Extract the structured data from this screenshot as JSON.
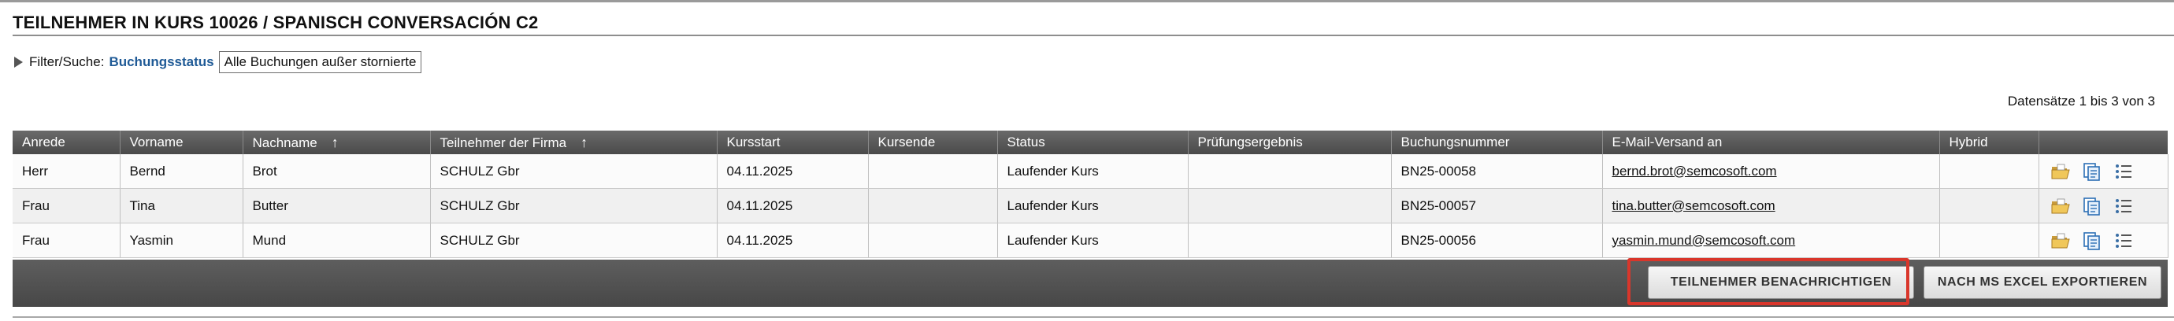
{
  "page": {
    "title": "TEILNEHMER IN KURS 10026 / SPANISCH CONVERSACIÓN C2"
  },
  "filter": {
    "label": "Filter/Suche:",
    "field": "Buchungsstatus",
    "value": "Alle Buchungen außer stornierte"
  },
  "records": {
    "text": "Datensätze 1 bis 3 von 3"
  },
  "table": {
    "columns": [
      "Anrede",
      "Vorname",
      "Nachname",
      "Teilnehmer der Firma",
      "Kursstart",
      "Kursende",
      "Status",
      "Prüfungsergebnis",
      "Buchungsnummer",
      "E-Mail-Versand an",
      "Hybrid",
      ""
    ],
    "sort_arrow": "↑",
    "rows": [
      {
        "anrede": "Herr",
        "vorname": "Bernd",
        "nachname": "Brot",
        "firma": "SCHULZ Gbr",
        "kursstart": "04.11.2025",
        "kursende": "",
        "status": "Laufender Kurs",
        "pruefung": "",
        "buchungsnummer": "BN25-00058",
        "email": "bernd.brot@semcosoft.com",
        "hybrid": ""
      },
      {
        "anrede": "Frau",
        "vorname": "Tina",
        "nachname": "Butter",
        "firma": "SCHULZ Gbr",
        "kursstart": "04.11.2025",
        "kursende": "",
        "status": "Laufender Kurs",
        "pruefung": "",
        "buchungsnummer": "BN25-00057",
        "email": "tina.butter@semcosoft.com",
        "hybrid": ""
      },
      {
        "anrede": "Frau",
        "vorname": "Yasmin",
        "nachname": "Mund",
        "firma": "SCHULZ Gbr",
        "kursstart": "04.11.2025",
        "kursende": "",
        "status": "Laufender Kurs",
        "pruefung": "",
        "buchungsnummer": "BN25-00056",
        "email": "yasmin.mund@semcosoft.com",
        "hybrid": ""
      }
    ],
    "row_icons": [
      "open-folder-icon",
      "copy-document-icon",
      "list-icon"
    ]
  },
  "footer": {
    "notify_label": "TEILNEHMER BENACHRICHTIGEN",
    "export_label": "NACH MS EXCEL EXPORTIEREN"
  },
  "colors": {
    "filter_link": "#1f5a96",
    "header_bg": "#555555",
    "highlight": "#d9362b"
  }
}
